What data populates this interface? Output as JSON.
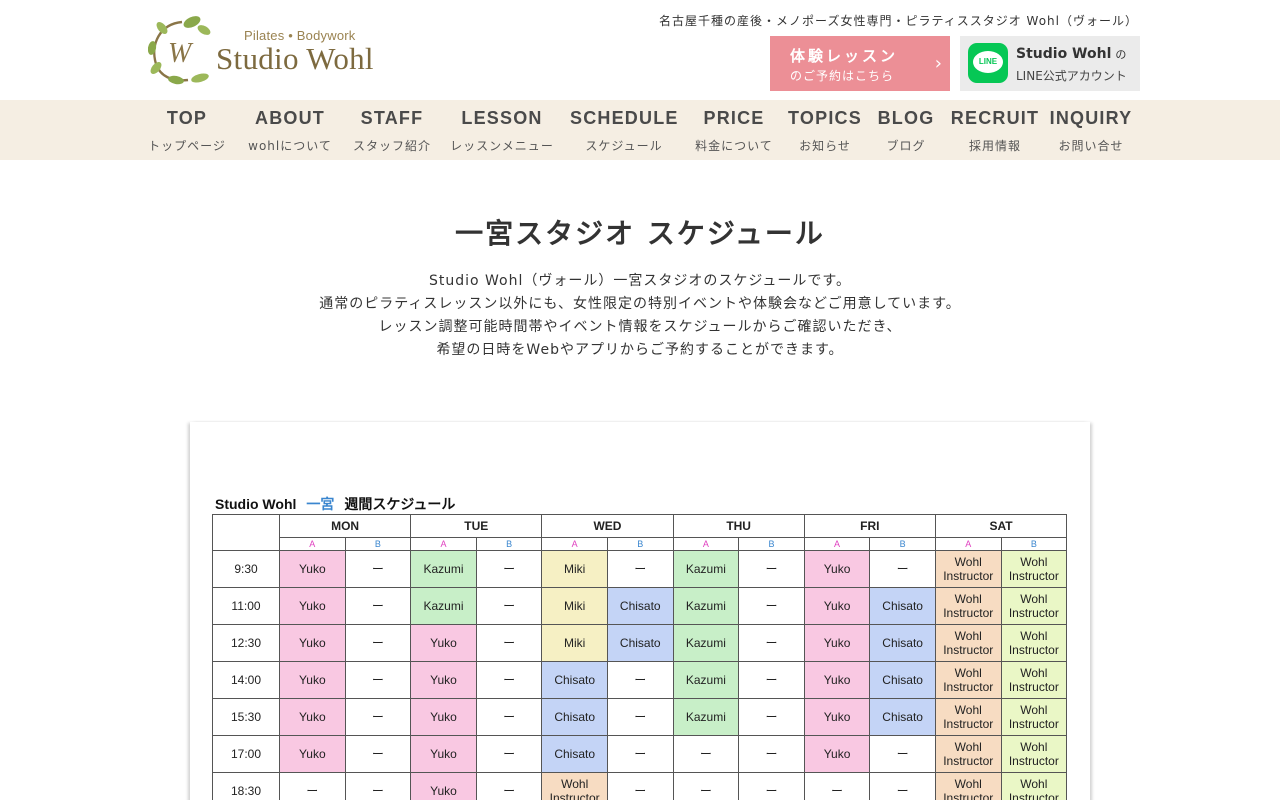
{
  "header": {
    "logo_sub": "Pilates • Bodywork",
    "logo_name": "Studio Wohl",
    "tagline": "名古屋千種の産後・メノポーズ女性専門・ピラティススタジオ Wohl（ヴォール）",
    "trial_button": {
      "line1": "体験レッスン",
      "line2": "のご予約はこちら"
    },
    "line_button": {
      "icon_text": "LINE",
      "line1": "Studio Wohl",
      "line1_suffix": "の",
      "line2": "LINE公式アカウント"
    }
  },
  "nav": [
    {
      "en": "TOP",
      "ja": "トップページ"
    },
    {
      "en": "ABOUT",
      "ja": "wohlについて"
    },
    {
      "en": "STAFF",
      "ja": "スタッフ紹介"
    },
    {
      "en": "LESSON",
      "ja": "レッスンメニュー"
    },
    {
      "en": "SCHEDULE",
      "ja": "スケジュール"
    },
    {
      "en": "PRICE",
      "ja": "料金について"
    },
    {
      "en": "TOPICS",
      "ja": "お知らせ"
    },
    {
      "en": "BLOG",
      "ja": "ブログ"
    },
    {
      "en": "RECRUIT",
      "ja": "採用情報"
    },
    {
      "en": "INQUIRY",
      "ja": "お問い合せ"
    }
  ],
  "main": {
    "title": "一宮スタジオ スケジュール",
    "intro": [
      "Studio Wohl（ヴォール）一宮スタジオのスケジュールです。",
      "通常のピラティスレッスン以外にも、女性限定の特別イベントや体験会などご用意しています。",
      "レッスン調整可能時間帯やイベント情報をスケジュールからご確認いただき、",
      "希望の日時をWebやアプリからご予約することができます。"
    ]
  },
  "schedule": {
    "title": "Studio Wohl",
    "location": "一宮",
    "subtitle": "週間スケジュール",
    "days": [
      "MON",
      "TUE",
      "WED",
      "THU",
      "FRI",
      "SAT"
    ],
    "sub_a": "A",
    "sub_b": "B",
    "rows": [
      {
        "time": "9:30",
        "cells": [
          "Yuko",
          "ー",
          "Kazumi",
          "ー",
          "Miki",
          "ー",
          "Kazumi",
          "ー",
          "Yuko",
          "ー",
          "Wohl Instructor",
          "Wohl Instructor"
        ]
      },
      {
        "time": "11:00",
        "cells": [
          "Yuko",
          "ー",
          "Kazumi",
          "ー",
          "Miki",
          "Chisato",
          "Kazumi",
          "ー",
          "Yuko",
          "Chisato",
          "Wohl Instructor",
          "Wohl Instructor"
        ]
      },
      {
        "time": "12:30",
        "cells": [
          "Yuko",
          "ー",
          "Yuko",
          "ー",
          "Miki",
          "Chisato",
          "Kazumi",
          "ー",
          "Yuko",
          "Chisato",
          "Wohl Instructor",
          "Wohl Instructor"
        ]
      },
      {
        "time": "14:00",
        "cells": [
          "Yuko",
          "ー",
          "Yuko",
          "ー",
          "Chisato",
          "ー",
          "Kazumi",
          "ー",
          "Yuko",
          "Chisato",
          "Wohl Instructor",
          "Wohl Instructor"
        ]
      },
      {
        "time": "15:30",
        "cells": [
          "Yuko",
          "ー",
          "Yuko",
          "ー",
          "Chisato",
          "ー",
          "Kazumi",
          "ー",
          "Yuko",
          "Chisato",
          "Wohl Instructor",
          "Wohl Instructor"
        ]
      },
      {
        "time": "17:00",
        "cells": [
          "Yuko",
          "ー",
          "Yuko",
          "ー",
          "Chisato",
          "ー",
          "ー",
          "ー",
          "Yuko",
          "ー",
          "Wohl Instructor",
          "Wohl Instructor"
        ]
      },
      {
        "time": "18:30",
        "cells": [
          "ー",
          "ー",
          "Yuko",
          "ー",
          "Wohl Instructor",
          "ー",
          "ー",
          "ー",
          "ー",
          "ー",
          "Wohl Instructor",
          "Wohl Instructor"
        ]
      }
    ],
    "colors": {
      "Yuko": "#f9c8e2",
      "Kazumi": "#c8efc8",
      "Miki": "#f6f0c4",
      "Chisato": "#c4d4f6",
      "Wohl Instructor (weekday)": "#f7dcc2",
      "Wohl Instructor (SAT B)": "#eaf7c6"
    }
  }
}
